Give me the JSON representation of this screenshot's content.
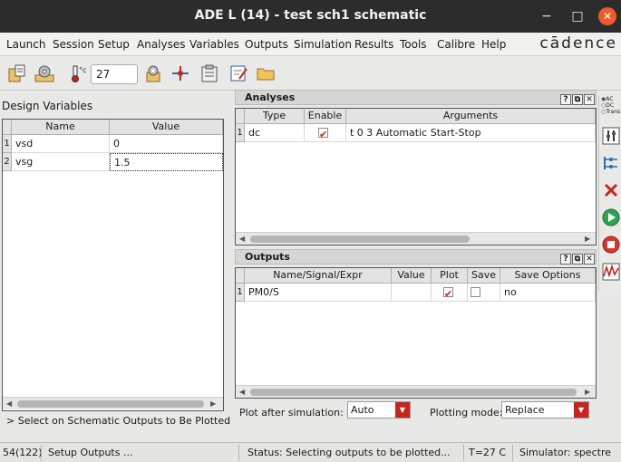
{
  "window": {
    "title": "ADE L (14) - test sch1 schematic",
    "minimize": "−",
    "maximize": "□",
    "close": "✕"
  },
  "menubar": {
    "items": [
      "Launch",
      "Session",
      "Setup",
      "Analyses",
      "Variables",
      "Outputs",
      "Simulation",
      "Results",
      "Tools",
      "Calibre",
      "Help"
    ],
    "brand": "cādence"
  },
  "toolbar": {
    "temperature": "27",
    "icons": [
      "open-state-icon",
      "setup-icon",
      "temperature-icon",
      "settings-icon",
      "split-icon",
      "clipboard-icon",
      "edit-icon",
      "folder-icon"
    ]
  },
  "design_variables": {
    "title": "Design Variables",
    "columns": [
      "Name",
      "Value"
    ],
    "rows": [
      {
        "num": "1",
        "name": "vsd",
        "value": "0"
      },
      {
        "num": "2",
        "name": "vsg",
        "value": "1.5"
      }
    ]
  },
  "analyses": {
    "title": "Analyses",
    "columns": [
      "Type",
      "Enable",
      "Arguments"
    ],
    "rows": [
      {
        "num": "1",
        "type": "dc",
        "enabled": true,
        "arguments": "t 0 3 Automatic Start-Stop"
      }
    ]
  },
  "outputs": {
    "title": "Outputs",
    "columns": [
      "Name/Signal/Expr",
      "Value",
      "Plot",
      "Save",
      "Save Options"
    ],
    "rows": [
      {
        "num": "1",
        "name": "PM0/S",
        "value": "",
        "plot": true,
        "save": false,
        "save_options": "no"
      }
    ]
  },
  "dock_buttons": [
    "?",
    "⧉",
    "✕"
  ],
  "hint": "> Select on Schematic Outputs to Be Plotted",
  "controls": {
    "plot_after_label": "Plot after simulation:",
    "plot_after_value": "Auto",
    "plotting_mode_label": "Plotting mode:",
    "plotting_mode_value": "Replace"
  },
  "radio_options": [
    "AC",
    "DC",
    "Trans"
  ],
  "statusbar": {
    "cell1": "54(122)",
    "cell2": "Setup Outputs ...",
    "cell3": "Status: Selecting  outputs  to  be  plotted...",
    "cell4": "T=27  C",
    "cell5": "Simulator: spectre"
  },
  "colors": {
    "accent_red": "#d0221c",
    "titlebar": "#2c2c2c",
    "close_button": "#ee5a2a"
  }
}
